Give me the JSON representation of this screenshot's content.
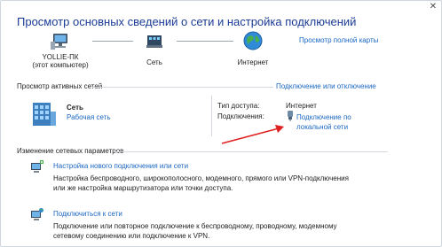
{
  "window": {
    "title": "Просмотр основных сведений о сети и настройка подключений",
    "close_glyph": "✕"
  },
  "network_map": {
    "computer_name": "YOLLIE-ПК",
    "computer_sub": "(этот компьютер)",
    "network_label": "Сеть",
    "internet_label": "Интернет",
    "full_map_link": "Просмотр полной карты"
  },
  "active_networks": {
    "header": "Просмотр активных сетей",
    "connect_disconnect_link": "Подключение или отключение",
    "network_name": "Сеть",
    "network_type_link": "Рабочая сеть",
    "access_type_label": "Тип доступа:",
    "access_type_value": "Интернет",
    "connections_label": "Подключения:",
    "connection_link_line1": "Подключение по",
    "connection_link_line2": "локальной сети"
  },
  "change_settings": {
    "header": "Изменение сетевых параметров",
    "items": [
      {
        "link": "Настройка нового подключения или сети",
        "desc_line1": "Настройка беспроводного, широкополосного, модемного, прямого или VPN-подключения",
        "desc_line2": "или же настройка маршрутизатора или точки доступа."
      },
      {
        "link": "Подключиться к сети",
        "desc_line1": "Подключение или повторное подключение к беспроводному, проводному, модемному",
        "desc_line2": "сетевому соединению или подключение к VPN."
      }
    ]
  },
  "colors": {
    "title": "#1b3c96",
    "link": "#1a66c2",
    "arrow": "#e02020"
  }
}
